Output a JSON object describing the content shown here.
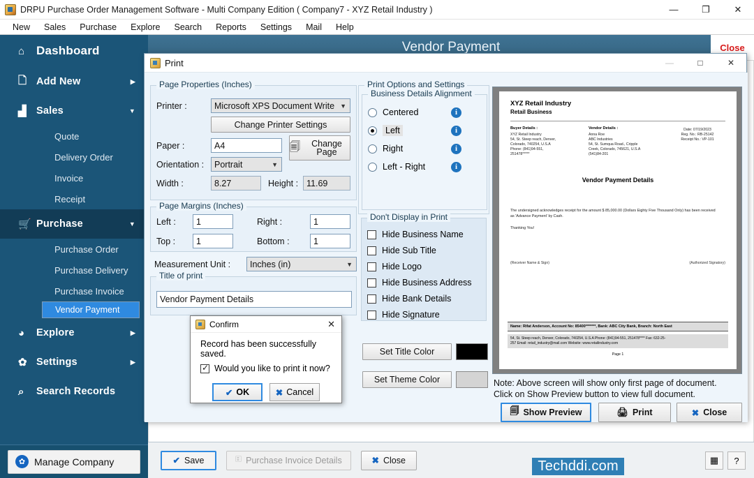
{
  "app": {
    "title": "DRPU Purchase Order Management Software - Multi Company Edition ( Company7 - XYZ Retail Industry )",
    "icon": "app-icon",
    "window_controls": {
      "minimize": "—",
      "maximize": "❐",
      "close": "✕"
    }
  },
  "menubar": {
    "items": [
      "New",
      "Sales",
      "Purchase",
      "Explore",
      "Search",
      "Reports",
      "Settings",
      "Mail",
      "Help"
    ]
  },
  "sidebar": {
    "items": [
      {
        "label": "Dashboard",
        "icon": "home-icon",
        "arrow": ""
      },
      {
        "label": "Add New",
        "icon": "add-file-icon",
        "arrow": "▶"
      },
      {
        "label": "Sales",
        "icon": "bar-chart-icon",
        "arrow": "▼"
      },
      {
        "label": "Purchase",
        "icon": "cart-icon",
        "arrow": "▼"
      },
      {
        "label": "Explore",
        "icon": "pie-chart-icon",
        "arrow": "▶"
      },
      {
        "label": "Settings",
        "icon": "gear-icon",
        "arrow": "▶"
      },
      {
        "label": "Search Records",
        "icon": "magnifier-icon",
        "arrow": ""
      }
    ],
    "sales_children": [
      "Quote",
      "Delivery Order",
      "Invoice",
      "Receipt"
    ],
    "purchase_children": [
      "Purchase Order",
      "Purchase Delivery",
      "Purchase Invoice",
      "Vendor Payment"
    ],
    "selected_child": "Vendor Payment",
    "manage_company": {
      "label": "Manage Company",
      "icon": "gear-circle-icon"
    },
    "bg_color": "#1b5578",
    "selected_color": "#2f8ae0"
  },
  "page": {
    "header_title": "Vendor Payment",
    "close_link": "Close",
    "bottom_buttons": [
      {
        "label": "Save",
        "icon": "check-icon",
        "state": "focused"
      },
      {
        "label": "Purchase Invoice Details",
        "icon": "document-icon",
        "state": "disabled"
      },
      {
        "label": "Close",
        "icon": "x-icon",
        "state": "normal"
      }
    ],
    "watermark": "Techddi.com",
    "corner_tools": [
      {
        "name": "calculator-icon",
        "glyph": "▦"
      },
      {
        "name": "help-icon",
        "glyph": "?"
      }
    ]
  },
  "print_dialog": {
    "title": "Print",
    "window_controls": {
      "minimize": "—",
      "maximize": "□",
      "close": "✕"
    },
    "page_properties": {
      "legend": "Page Properties (Inches)",
      "printer_label": "Printer :",
      "printer_value": "Microsoft XPS Document Write",
      "change_printer_settings": "Change Printer Settings",
      "paper_label": "Paper :",
      "paper_value": "A4",
      "change_page": "Change Page",
      "orientation_label": "Orientation :",
      "orientation_value": "Portrait",
      "width_label": "Width :",
      "width_value": "8.27",
      "height_label": "Height :",
      "height_value": "11.69"
    },
    "page_margins": {
      "legend": "Page Margins (Inches)",
      "left_label": "Left :",
      "left_value": "1",
      "right_label": "Right :",
      "right_value": "1",
      "top_label": "Top  :",
      "top_value": "1",
      "bottom_label": "Bottom  :",
      "bottom_value": "1"
    },
    "measurement_unit_label": "Measurement Unit :",
    "measurement_unit_value": "Inches (in)",
    "title_of_print": {
      "legend": "Title of print",
      "value": "Vendor Payment Details"
    },
    "print_options": {
      "legend": "Print Options and Settings",
      "alignment_legend": "Business Details Alignment",
      "alignment_options": [
        {
          "label": "Centered",
          "selected": false
        },
        {
          "label": "Left",
          "selected": true
        },
        {
          "label": "Right",
          "selected": false
        },
        {
          "label": "Left - Right",
          "selected": false
        }
      ],
      "hide_legend": "Don't Display in Print",
      "hide_options": [
        {
          "label": "Hide Business Name",
          "checked": false
        },
        {
          "label": "Hide Sub Title",
          "checked": false
        },
        {
          "label": "Hide Logo",
          "checked": false
        },
        {
          "label": "Hide Business Address",
          "checked": false
        },
        {
          "label": "Hide Bank Details",
          "checked": false
        },
        {
          "label": "Hide Signature",
          "checked": false
        }
      ],
      "set_title_color": "Set Title Color",
      "title_color_value": "#000000",
      "set_theme_color": "Set Theme Color",
      "theme_color_value": "#d4d4d4"
    },
    "note_line1": "Note: Above screen will show only first page of document.",
    "note_line2": "Click on Show Preview button to view full document.",
    "action_buttons": [
      {
        "label": "Show Preview",
        "icon": "preview-icon",
        "state": "focused"
      },
      {
        "label": "Print",
        "icon": "printer-icon",
        "state": "normal"
      },
      {
        "label": "Close",
        "icon": "x-icon",
        "state": "normal"
      }
    ]
  },
  "document_preview": {
    "business_name": "XYZ Retail Industry",
    "business_subtitle": "Retail Business",
    "buyer_heading": "Buyer Details :",
    "buyer_lines": [
      "XYZ Retail Industry",
      "54, St. Steep reach, Denver,",
      "Colorado, 740254, U.S.A",
      "Phone: (841)94-551,",
      "251478*****"
    ],
    "vendor_heading": "Vendor Details :",
    "vendor_lines": [
      "Anna Roe",
      "ABC Industries",
      "54, St. Sumqua Road., Cripple",
      "Creek, Colorado, 745621, U.S.A",
      "(541)84-201"
    ],
    "meta_lines": [
      "Date: 07/19/2023",
      "Reg. No.:  RB-25142",
      "Receipt No.:  VP-101"
    ],
    "doc_title": "Vendor Payment Details",
    "body_text": "The undersigned acknowledges receipt for the amount $ 85,000.00 (Dollars Eighty Five Thousand Only) has been received as 'Advance Payment' by Cash.",
    "thanks": "Thanking You!",
    "receiver_sign": "(Receiver Name & Sign)",
    "authorized_sign": "(Authorized Signatory)",
    "bank_line": "Name: Rifat Anderson, Account No: 85400*******, Bank: ABC City Bank, Branch: North East",
    "footer_line1": "54, St. Steep reach, Denver, Colorado, 740254, U.S.A  Phone: (841)94-551, 251478****  Fax: 632-25-",
    "footer_line2": "257  Email: retail_industry@mail.com  Website: www.retailindustry.com",
    "page_label": "Page 1"
  },
  "confirm_dialog": {
    "title": "Confirm",
    "close_glyph": "✕",
    "message": "Record has been successfully saved.",
    "checkbox_label": "Would you like to print it now?",
    "checkbox_checked": true,
    "ok_label": "OK",
    "cancel_label": "Cancel"
  }
}
